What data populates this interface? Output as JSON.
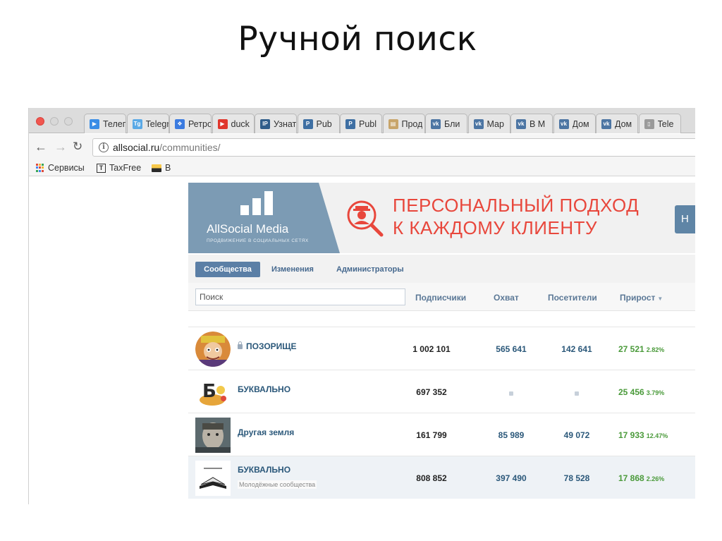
{
  "slide": {
    "title": "Ручной поиск"
  },
  "browser": {
    "tabs": [
      {
        "label": "Телегр",
        "color": "#3a8de6",
        "glyph": "▶"
      },
      {
        "label": "Telegr",
        "color": "#5aa9e6",
        "glyph": "Tg"
      },
      {
        "label": "Ретро",
        "color": "#3b7be0",
        "glyph": "❖"
      },
      {
        "label": "duck",
        "color": "#e0362c",
        "glyph": "▶"
      },
      {
        "label": "Узнать",
        "color": "#2f5d8a",
        "glyph": "IP"
      },
      {
        "label": "Pub",
        "color": "#3e6fa3",
        "glyph": "P"
      },
      {
        "label": "Publ",
        "color": "#3e6fa3",
        "glyph": "P"
      },
      {
        "label": "Прод",
        "color": "#c8a56a",
        "glyph": "▤"
      },
      {
        "label": "Бли",
        "color": "#4c75a3",
        "glyph": "vk"
      },
      {
        "label": "Мар",
        "color": "#4c75a3",
        "glyph": "vk"
      },
      {
        "label": "В М",
        "color": "#4c75a3",
        "glyph": "vk"
      },
      {
        "label": "Дом",
        "color": "#4c75a3",
        "glyph": "vk"
      },
      {
        "label": "Дом",
        "color": "#4c75a3",
        "glyph": "vk"
      },
      {
        "label": "Tele",
        "color": "#9a9a9a",
        "glyph": "▯"
      }
    ],
    "address": {
      "host": "allsocial.ru",
      "path": "/communities/"
    },
    "bookmarks": [
      {
        "label": "Сервисы",
        "icon": "apps-grid-icon"
      },
      {
        "label": "TaxFree",
        "icon": "taxfree-icon"
      },
      {
        "label": "В",
        "icon": "image-bookmark-icon"
      }
    ]
  },
  "site": {
    "brand": {
      "name": "AllSocial Media",
      "tagline": "ПРОДВИЖЕНИЕ В СОЦИАЛЬНЫХ СЕТЯХ"
    },
    "promo": {
      "line1": "ПЕРСОНАЛЬНЫЙ ПОДХОД",
      "line2": "К КАЖДОМУ КЛИЕНТУ",
      "cta": "Н"
    },
    "nav_tabs": [
      "Сообщества",
      "Изменения",
      "Администраторы"
    ],
    "search_placeholder": "Поиск",
    "columns": {
      "subscribers": "Подписчики",
      "reach": "Охват",
      "visitors": "Посетители",
      "growth": "Прирост"
    },
    "rows": [
      {
        "name": "ПОЗОРИЩЕ",
        "locked": true,
        "subscribers": "1 002 101",
        "reach": "565 641",
        "visitors": "142 641",
        "growth": "27 521",
        "growth_pct": "2.82%"
      },
      {
        "name": "БУКВАЛЬНО",
        "locked": false,
        "subscribers": "697 352",
        "reach": "",
        "visitors": "",
        "growth": "25 456",
        "growth_pct": "3.79%"
      },
      {
        "name": "Другая земля",
        "locked": false,
        "subscribers": "161 799",
        "reach": "85 989",
        "visitors": "49 072",
        "growth": "17 933",
        "growth_pct": "12.47%"
      },
      {
        "name": "БУКВАЛЬНО",
        "subtitle": "Молодёжные сообщества",
        "locked": false,
        "subscribers": "808 852",
        "reach": "397 490",
        "visitors": "78 528",
        "growth": "17 868",
        "growth_pct": "2.26%"
      }
    ]
  },
  "colors": {
    "accent_blue": "#5b7fa6",
    "promo_red": "#e8473c",
    "growth_green": "#4a9a3a",
    "brand_panel": "#7c9bb4"
  }
}
